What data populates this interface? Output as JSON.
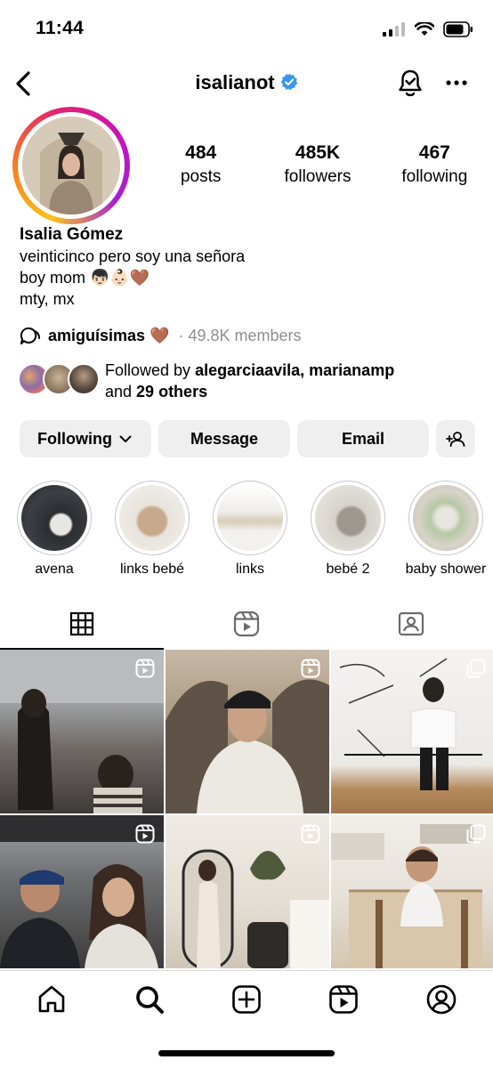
{
  "status_bar": {
    "time": "11:44"
  },
  "header": {
    "username": "isalianot",
    "verified": true
  },
  "profile": {
    "stats": [
      {
        "value": "484",
        "label": "posts"
      },
      {
        "value": "485K",
        "label": "followers"
      },
      {
        "value": "467",
        "label": "following"
      }
    ],
    "name": "Isalia Gómez",
    "bio_lines": [
      "veinticinco pero soy una señora",
      "boy mom 👦🏻👶🏻🤎",
      "mty, mx"
    ],
    "channel": {
      "name": "amiguísimas 🤎",
      "members": "· 49.8K members"
    },
    "followed_by": {
      "prefix": "Followed by ",
      "names": "alegarciaavila, marianamp",
      "and": "and ",
      "others": "29 others"
    }
  },
  "actions": {
    "following_label": "Following",
    "message_label": "Message",
    "email_label": "Email"
  },
  "highlights": [
    {
      "label": "avena"
    },
    {
      "label": "links bebé"
    },
    {
      "label": "links"
    },
    {
      "label": "bebé 2"
    },
    {
      "label": "baby shower"
    }
  ],
  "tabs": [
    {
      "name": "grid-icon",
      "active": true
    },
    {
      "name": "reels-icon",
      "active": false
    },
    {
      "name": "tagged-icon",
      "active": false
    }
  ],
  "posts": [
    {
      "type": "reel"
    },
    {
      "type": "reel"
    },
    {
      "type": "carousel"
    },
    {
      "type": "reel"
    },
    {
      "type": "reel"
    },
    {
      "type": "carousel"
    }
  ],
  "colors": {
    "verified_blue": "#3897f0",
    "button_gray": "#efefef",
    "muted_text": "#8e8e8e"
  }
}
